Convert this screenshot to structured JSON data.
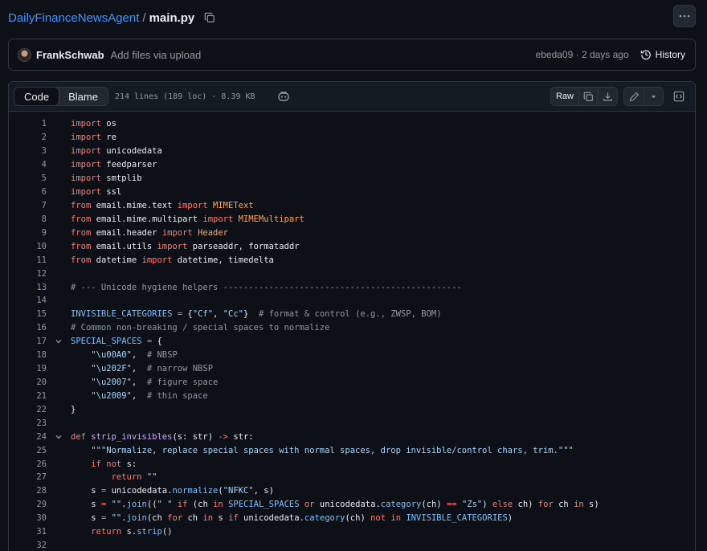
{
  "breadcrumb": {
    "repo": "DailyFinanceNewsAgent",
    "separator": "/",
    "file": "main.py"
  },
  "commit": {
    "author": "FrankSchwab",
    "message": "Add files via upload",
    "hash": "ebeda09",
    "time": "2 days ago",
    "history_label": "History"
  },
  "file_header": {
    "tabs": [
      "Code",
      "Blame"
    ],
    "active_tab": "Code",
    "meta": "214 lines (189 loc) · 8.39 KB",
    "raw_label": "Raw"
  },
  "icons": [
    "copy-icon",
    "kebab-icon",
    "history-icon",
    "copilot-icon",
    "download-icon",
    "pencil-icon",
    "triangle-down-icon",
    "code-square-icon",
    "chevron-down-icon"
  ],
  "colors": {
    "background": "#0d1117",
    "link": "#4493f8",
    "keyword": "#ff7b72",
    "function": "#d2a8ff",
    "string": "#a5d6ff",
    "comment": "#9198a1",
    "builtin": "#79c0ff",
    "class": "#ffa657"
  },
  "code": {
    "lines": [
      {
        "n": "1",
        "fold": false,
        "tokens": [
          [
            "kw",
            "import"
          ],
          [
            "t",
            " os"
          ]
        ]
      },
      {
        "n": "2",
        "fold": false,
        "tokens": [
          [
            "kw",
            "import"
          ],
          [
            "t",
            " re"
          ]
        ]
      },
      {
        "n": "3",
        "fold": false,
        "tokens": [
          [
            "kw",
            "import"
          ],
          [
            "t",
            " unicodedata"
          ]
        ]
      },
      {
        "n": "4",
        "fold": false,
        "tokens": [
          [
            "kw",
            "import"
          ],
          [
            "t",
            " feedparser"
          ]
        ]
      },
      {
        "n": "5",
        "fold": false,
        "tokens": [
          [
            "kw",
            "import"
          ],
          [
            "t",
            " smtplib"
          ]
        ]
      },
      {
        "n": "6",
        "fold": false,
        "tokens": [
          [
            "kw",
            "import"
          ],
          [
            "t",
            " ssl"
          ]
        ]
      },
      {
        "n": "7",
        "fold": false,
        "tokens": [
          [
            "kw",
            "from"
          ],
          [
            "t",
            " email.mime.text "
          ],
          [
            "kw",
            "import"
          ],
          [
            "t",
            " "
          ],
          [
            "cl",
            "MIMEText"
          ]
        ]
      },
      {
        "n": "8",
        "fold": false,
        "tokens": [
          [
            "kw",
            "from"
          ],
          [
            "t",
            " email.mime.multipart "
          ],
          [
            "kw",
            "import"
          ],
          [
            "t",
            " "
          ],
          [
            "cl",
            "MIMEMultipart"
          ]
        ]
      },
      {
        "n": "9",
        "fold": false,
        "tokens": [
          [
            "kw",
            "from"
          ],
          [
            "t",
            " email.header "
          ],
          [
            "kw",
            "import"
          ],
          [
            "t",
            " "
          ],
          [
            "cl",
            "Header"
          ]
        ]
      },
      {
        "n": "10",
        "fold": false,
        "tokens": [
          [
            "kw",
            "from"
          ],
          [
            "t",
            " email.utils "
          ],
          [
            "kw",
            "import"
          ],
          [
            "t",
            " parseaddr, formataddr"
          ]
        ]
      },
      {
        "n": "11",
        "fold": false,
        "tokens": [
          [
            "kw",
            "from"
          ],
          [
            "t",
            " datetime "
          ],
          [
            "kw",
            "import"
          ],
          [
            "t",
            " datetime, timedelta"
          ]
        ]
      },
      {
        "n": "12",
        "fold": false,
        "tokens": []
      },
      {
        "n": "13",
        "fold": false,
        "tokens": [
          [
            "cm",
            "# --- Unicode hygiene helpers -----------------------------------------------"
          ]
        ]
      },
      {
        "n": "14",
        "fold": false,
        "tokens": []
      },
      {
        "n": "15",
        "fold": false,
        "tokens": [
          [
            "bi",
            "INVISIBLE_CATEGORIES"
          ],
          [
            "t",
            " "
          ],
          [
            "kw",
            "="
          ],
          [
            "t",
            " {"
          ],
          [
            "st",
            "\"Cf\""
          ],
          [
            "t",
            ", "
          ],
          [
            "st",
            "\"Cc\""
          ],
          [
            "t",
            "}  "
          ],
          [
            "cm",
            "# format & control (e.g., ZWSP, BOM)"
          ]
        ]
      },
      {
        "n": "16",
        "fold": false,
        "tokens": [
          [
            "cm",
            "# Common non-breaking / special spaces to normalize"
          ]
        ]
      },
      {
        "n": "17",
        "fold": true,
        "tokens": [
          [
            "bi",
            "SPECIAL_SPACES"
          ],
          [
            "t",
            " "
          ],
          [
            "kw",
            "="
          ],
          [
            "t",
            " {"
          ]
        ]
      },
      {
        "n": "18",
        "fold": false,
        "tokens": [
          [
            "t",
            "    "
          ],
          [
            "st",
            "\"\\u00A0\""
          ],
          [
            "t",
            ",  "
          ],
          [
            "cm",
            "# NBSP"
          ]
        ]
      },
      {
        "n": "19",
        "fold": false,
        "tokens": [
          [
            "t",
            "    "
          ],
          [
            "st",
            "\"\\u202F\""
          ],
          [
            "t",
            ",  "
          ],
          [
            "cm",
            "# narrow NBSP"
          ]
        ]
      },
      {
        "n": "20",
        "fold": false,
        "tokens": [
          [
            "t",
            "    "
          ],
          [
            "st",
            "\"\\u2007\""
          ],
          [
            "t",
            ",  "
          ],
          [
            "cm",
            "# figure space"
          ]
        ]
      },
      {
        "n": "21",
        "fold": false,
        "tokens": [
          [
            "t",
            "    "
          ],
          [
            "st",
            "\"\\u2009\""
          ],
          [
            "t",
            ",  "
          ],
          [
            "cm",
            "# thin space"
          ]
        ]
      },
      {
        "n": "22",
        "fold": false,
        "tokens": [
          [
            "t",
            "}"
          ]
        ]
      },
      {
        "n": "23",
        "fold": false,
        "tokens": []
      },
      {
        "n": "24",
        "fold": true,
        "tokens": [
          [
            "kw",
            "def"
          ],
          [
            "t",
            " "
          ],
          [
            "fn",
            "strip_invisibles"
          ],
          [
            "t",
            "(s: str) "
          ],
          [
            "kw",
            "->"
          ],
          [
            "t",
            " str:"
          ]
        ]
      },
      {
        "n": "25",
        "fold": false,
        "tokens": [
          [
            "t",
            "    "
          ],
          [
            "st",
            "\"\"\"Normalize, replace special spaces with normal spaces, drop invisible/control chars, trim.\"\"\""
          ]
        ]
      },
      {
        "n": "26",
        "fold": false,
        "tokens": [
          [
            "t",
            "    "
          ],
          [
            "kw",
            "if"
          ],
          [
            "t",
            " "
          ],
          [
            "kw",
            "not"
          ],
          [
            "t",
            " s:"
          ]
        ]
      },
      {
        "n": "27",
        "fold": false,
        "tokens": [
          [
            "t",
            "        "
          ],
          [
            "kw",
            "return"
          ],
          [
            "t",
            " "
          ],
          [
            "st",
            "\"\""
          ]
        ]
      },
      {
        "n": "28",
        "fold": false,
        "tokens": [
          [
            "t",
            "    s "
          ],
          [
            "kw",
            "="
          ],
          [
            "t",
            " unicodedata."
          ],
          [
            "bi",
            "normalize"
          ],
          [
            "t",
            "("
          ],
          [
            "st",
            "\"NFKC\""
          ],
          [
            "t",
            ", s)"
          ]
        ]
      },
      {
        "n": "29",
        "fold": false,
        "tokens": [
          [
            "t",
            "    s "
          ],
          [
            "kw",
            "="
          ],
          [
            "t",
            " "
          ],
          [
            "st",
            "\"\""
          ],
          [
            "t",
            "."
          ],
          [
            "bi",
            "join"
          ],
          [
            "t",
            "(("
          ],
          [
            "st",
            "\" \""
          ],
          [
            "t",
            " "
          ],
          [
            "kw",
            "if"
          ],
          [
            "t",
            " (ch "
          ],
          [
            "kw",
            "in"
          ],
          [
            "t",
            " "
          ],
          [
            "bi",
            "SPECIAL_SPACES"
          ],
          [
            "t",
            " "
          ],
          [
            "kw",
            "or"
          ],
          [
            "t",
            " unicodedata."
          ],
          [
            "bi",
            "category"
          ],
          [
            "t",
            "(ch) "
          ],
          [
            "kw",
            "=="
          ],
          [
            "t",
            " "
          ],
          [
            "st",
            "\"Zs\""
          ],
          [
            "t",
            ") "
          ],
          [
            "kw",
            "else"
          ],
          [
            "t",
            " ch) "
          ],
          [
            "kw",
            "for"
          ],
          [
            "t",
            " ch "
          ],
          [
            "kw",
            "in"
          ],
          [
            "t",
            " s)"
          ]
        ]
      },
      {
        "n": "30",
        "fold": false,
        "tokens": [
          [
            "t",
            "    s "
          ],
          [
            "kw",
            "="
          ],
          [
            "t",
            " "
          ],
          [
            "st",
            "\"\""
          ],
          [
            "t",
            "."
          ],
          [
            "bi",
            "join"
          ],
          [
            "t",
            "(ch "
          ],
          [
            "kw",
            "for"
          ],
          [
            "t",
            " ch "
          ],
          [
            "kw",
            "in"
          ],
          [
            "t",
            " s "
          ],
          [
            "kw",
            "if"
          ],
          [
            "t",
            " unicodedata."
          ],
          [
            "bi",
            "category"
          ],
          [
            "t",
            "(ch) "
          ],
          [
            "kw",
            "not in"
          ],
          [
            "t",
            " "
          ],
          [
            "bi",
            "INVISIBLE_CATEGORIES"
          ],
          [
            "t",
            ")"
          ]
        ]
      },
      {
        "n": "31",
        "fold": false,
        "tokens": [
          [
            "t",
            "    "
          ],
          [
            "kw",
            "return"
          ],
          [
            "t",
            " s."
          ],
          [
            "bi",
            "strip"
          ],
          [
            "t",
            "()"
          ]
        ]
      },
      {
        "n": "32",
        "fold": false,
        "tokens": []
      }
    ]
  }
}
